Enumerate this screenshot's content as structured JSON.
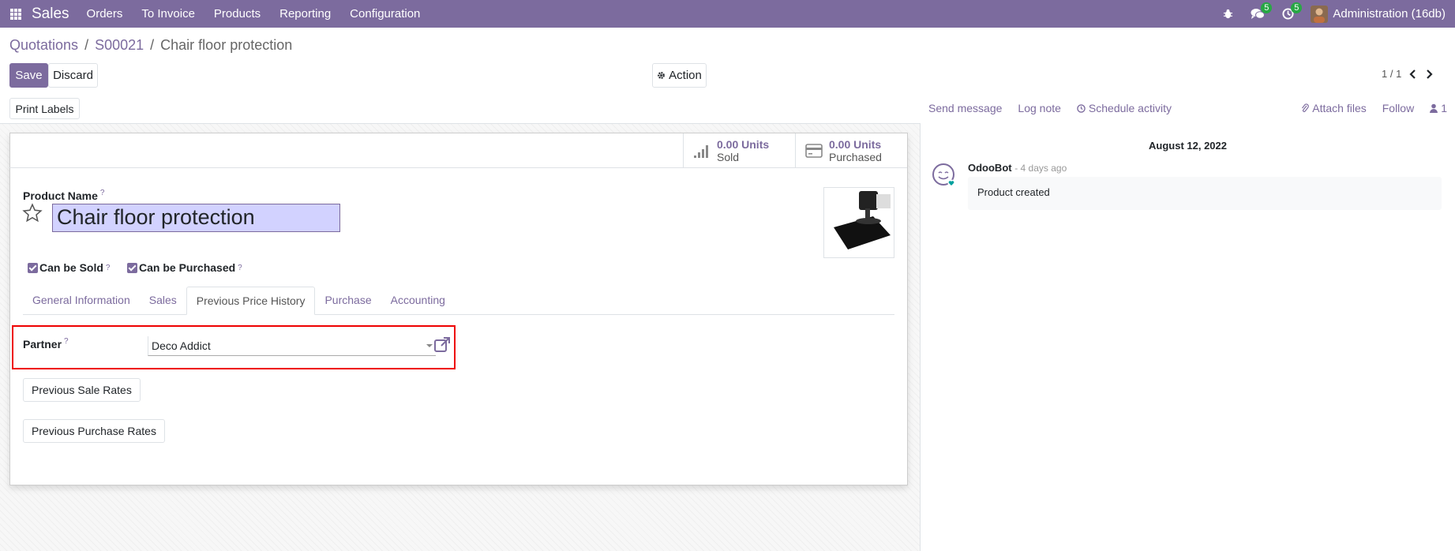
{
  "navbar": {
    "app_name": "Sales",
    "menu": [
      "Orders",
      "To Invoice",
      "Products",
      "Reporting",
      "Configuration"
    ],
    "messages_count": "5",
    "activities_count": "5",
    "user": "Administration (16db)"
  },
  "breadcrumb": {
    "items": [
      "Quotations",
      "S00021",
      "Chair floor protection"
    ],
    "separator": "/"
  },
  "control": {
    "save_label": "Save",
    "discard_label": "Discard",
    "action_label": "Action",
    "pager": "1 / 1"
  },
  "statusbar": {
    "print_labels": "Print Labels"
  },
  "smart_buttons": [
    {
      "value": "0.00 Units",
      "label": "Sold",
      "icon": "bar-chart-icon"
    },
    {
      "value": "0.00 Units",
      "label": "Purchased",
      "icon": "credit-card-icon"
    }
  ],
  "form": {
    "product_name_label": "Product Name",
    "help_mark": "?",
    "product_name": "Chair floor protection",
    "can_be_sold": "Can be Sold",
    "can_be_purchased": "Can be Purchased",
    "tabs": [
      "General Information",
      "Sales",
      "Previous Price History",
      "Purchase",
      "Accounting"
    ],
    "active_tab": "Previous Price History",
    "partner_label": "Partner",
    "partner_value": "Deco Addict",
    "previous_sale_rates": "Previous Sale Rates",
    "previous_purchase_rates": "Previous Purchase Rates"
  },
  "chatter": {
    "send_message": "Send message",
    "log_note": "Log note",
    "schedule_activity": "Schedule activity",
    "attach_files": "Attach files",
    "follow": "Follow",
    "followers_count": "1",
    "date": "August 12, 2022",
    "author": "OdooBot",
    "time": "- 4 days ago",
    "body": "Product created"
  },
  "colors": {
    "brand": "#7c6b9e",
    "highlight_border": "#ee0000",
    "input_highlight": "#d2d2ff"
  }
}
